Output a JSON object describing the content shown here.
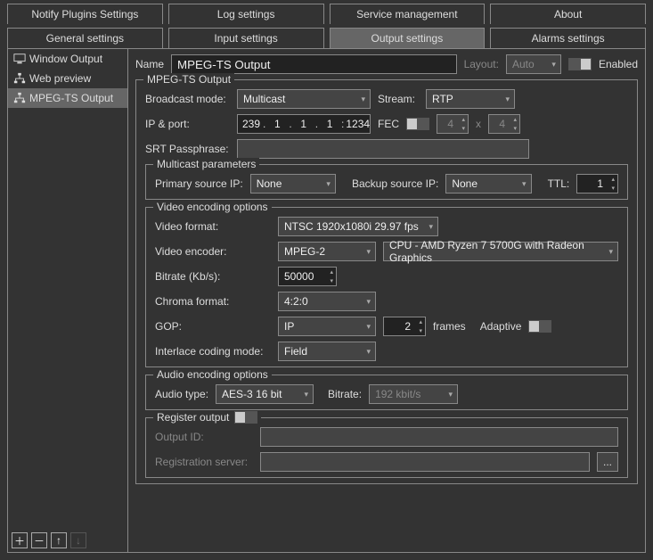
{
  "topTabs": [
    {
      "label": "Notify Plugins Settings"
    },
    {
      "label": "Log settings"
    },
    {
      "label": "Service management"
    },
    {
      "label": "About"
    }
  ],
  "subTabs": [
    {
      "label": "General settings"
    },
    {
      "label": "Input settings"
    },
    {
      "label": "Output settings",
      "active": true
    },
    {
      "label": "Alarms settings"
    }
  ],
  "sidebar": {
    "items": [
      {
        "label": "Window Output",
        "icon": "screen"
      },
      {
        "label": "Web preview",
        "icon": "tree"
      },
      {
        "label": "MPEG-TS Output",
        "icon": "tree",
        "selected": true
      }
    ]
  },
  "header": {
    "nameLabel": "Name",
    "nameValue": "MPEG-TS Output",
    "layoutLabel": "Layout:",
    "layoutValue": "Auto",
    "enabledLabel": "Enabled"
  },
  "mpegts": {
    "groupLabel": "MPEG-TS Output",
    "broadcastModeLabel": "Broadcast mode:",
    "broadcastModeValue": "Multicast",
    "streamLabel": "Stream:",
    "streamValue": "RTP",
    "ipPortLabel": "IP & port:",
    "ip": [
      "239",
      "1",
      "1",
      "1"
    ],
    "port": "1234",
    "fecLabel": "FEC",
    "fecA": "4",
    "fecX": "x",
    "fecB": "4",
    "srtLabel": "SRT Passphrase:",
    "srtValue": ""
  },
  "multicast": {
    "groupLabel": "Multicast parameters",
    "primaryLabel": "Primary source IP:",
    "primaryValue": "None",
    "backupLabel": "Backup source IP:",
    "backupValue": "None",
    "ttlLabel": "TTL:",
    "ttlValue": "1"
  },
  "video": {
    "groupLabel": "Video encoding options",
    "formatLabel": "Video format:",
    "formatValue": "NTSC 1920x1080i 29.97 fps",
    "encoderLabel": "Video encoder:",
    "encoderValue": "MPEG-2",
    "deviceValue": "CPU - AMD Ryzen 7 5700G with Radeon Graphics",
    "bitrateLabel": "Bitrate (Kb/s):",
    "bitrateValue": "50000",
    "chromaLabel": "Chroma format:",
    "chromaValue": "4:2:0",
    "gopLabel": "GOP:",
    "gopMode": "IP",
    "gopValue": "2",
    "framesLabel": "frames",
    "adaptiveLabel": "Adaptive",
    "interlaceLabel": "Interlace coding mode:",
    "interlaceValue": "Field"
  },
  "audio": {
    "groupLabel": "Audio encoding options",
    "typeLabel": "Audio type:",
    "typeValue": "AES-3 16 bit",
    "bitrateLabel": "Bitrate:",
    "bitrateValue": "192 kbit/s"
  },
  "register": {
    "groupLabel": "Register output",
    "outputIdLabel": "Output ID:",
    "outputIdValue": "",
    "serverLabel": "Registration server:",
    "serverValue": "",
    "browse": "..."
  }
}
